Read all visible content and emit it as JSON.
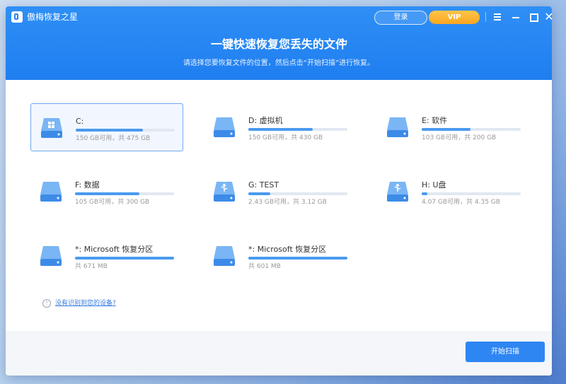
{
  "app": {
    "title": "傲梅恢复之星"
  },
  "header": {
    "login_label": "登录",
    "vip_label": "VIP",
    "headline": "一键快速恢复您丢失的文件",
    "subtitle": "请选择您要恢复文件的位置，然后点击“开始扫描”进行恢复。"
  },
  "drives": [
    {
      "name": "C:",
      "info": "150 GB可用，共 475 GB",
      "used_fraction": 0.68,
      "icon": "windows-drive-icon",
      "selected": true
    },
    {
      "name": "D: 虚拟机",
      "info": "150 GB可用，共 430 GB",
      "used_fraction": 0.65,
      "icon": "drive-icon"
    },
    {
      "name": "E: 软件",
      "info": "103 GB可用，共 200 GB",
      "used_fraction": 0.49,
      "icon": "drive-icon"
    },
    {
      "name": "F: 数据",
      "info": "105 GB可用，共 300 GB",
      "used_fraction": 0.65,
      "icon": "drive-icon"
    },
    {
      "name": "G: TEST",
      "info": "2.43 GB可用，共 3.12 GB",
      "used_fraction": 0.22,
      "icon": "usb-drive-icon"
    },
    {
      "name": "H: U盘",
      "info": "4.07 GB可用，共 4.35 GB",
      "used_fraction": 0.06,
      "icon": "usb-drive-icon"
    },
    {
      "name": "*: Microsoft 恢复分区",
      "info": "共 671 MB",
      "used_fraction": 1.0,
      "icon": "drive-icon"
    },
    {
      "name": "*: Microsoft 恢复分区",
      "info": "共 601 MB",
      "used_fraction": 1.0,
      "icon": "drive-icon"
    }
  ],
  "help": {
    "link_text": "没有识别到您的设备?"
  },
  "footer": {
    "start_label": "开始扫描"
  },
  "colors": {
    "accent": "#2e86f3",
    "vip": "#f9a620",
    "bar": "#4a9af0"
  }
}
